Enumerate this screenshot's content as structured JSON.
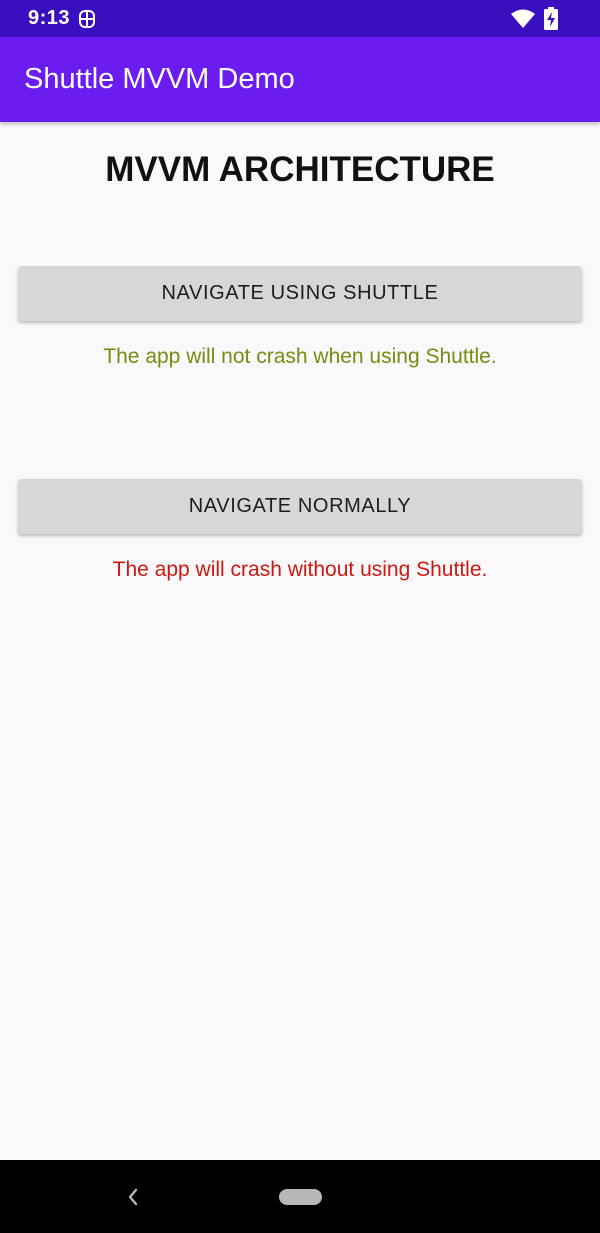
{
  "status_bar": {
    "time": "9:13",
    "app_icon": "shuttle-notification-icon",
    "wifi_icon": "wifi-icon",
    "battery_icon": "battery-charging-icon"
  },
  "app_bar": {
    "title": "Shuttle MVVM Demo",
    "color": "#6b1cf0"
  },
  "main": {
    "title": "MVVM ARCHITECTURE",
    "shuttle_button_label": "NAVIGATE USING SHUTTLE",
    "shuttle_note": "The app will not crash when using Shuttle.",
    "normal_button_label": "NAVIGATE NORMALLY",
    "normal_note": "The app will crash without using Shuttle."
  },
  "nav_bar": {
    "back_icon": "back-icon",
    "home_icon": "home-pill-icon"
  }
}
